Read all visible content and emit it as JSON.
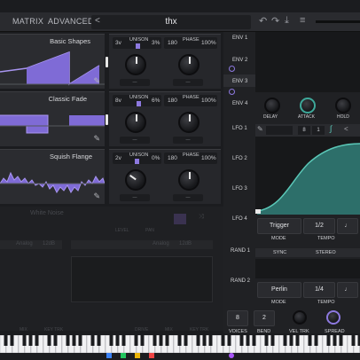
{
  "tabs": [
    "MATRIX",
    "ADVANCED"
  ],
  "preset": {
    "name": "thx",
    "prev": "<",
    "next": ">"
  },
  "oscillators": [
    {
      "wave_name": "Basic Shapes",
      "voices": "3v",
      "unison": "UNISON",
      "unison_pct": "3%",
      "phase_label": "PHASE",
      "phase": "180",
      "phase_pct": "100%"
    },
    {
      "wave_name": "Classic Fade",
      "voices": "8v",
      "unison": "UNISON",
      "unison_pct": "6%",
      "phase_label": "PHASE",
      "phase": "180",
      "phase_pct": "100%"
    },
    {
      "wave_name": "Squish Flange",
      "voices": "2v",
      "unison": "UNISON",
      "unison_pct": "0%",
      "phase_label": "PHASE",
      "phase": "180",
      "phase_pct": "100%"
    }
  ],
  "noise": {
    "name": "White Noise",
    "level": "LEVEL",
    "pan": "PAN"
  },
  "filters": [
    {
      "type": "Analog",
      "slope": "12dB"
    },
    {
      "type": "Analog",
      "slope": "12dB"
    }
  ],
  "filter_caps": [
    "MIX",
    "KEY TRK",
    "DRIVE",
    "MIX",
    "KEY TRK"
  ],
  "env": {
    "labels": [
      "ENV 1",
      "ENV 2",
      "ENV 3",
      "ENV 4"
    ],
    "knobs": [
      "DELAY",
      "ATTACK",
      "HOLD"
    ]
  },
  "lfo": {
    "labels": [
      "LFO 1",
      "LFO 2",
      "LFO 3",
      "LFO 4"
    ],
    "rate_a": "8",
    "rate_b": "1",
    "mode_value": "Trigger",
    "mode_cap": "MODE",
    "tempo_value": "1/2",
    "tempo_cap": "TEMPO"
  },
  "rand": {
    "labels": [
      "RAND 1",
      "RAND 2"
    ],
    "sync": "SYNC",
    "stereo": "STEREO",
    "mode_value": "Perlin",
    "mode_cap": "MODE",
    "tempo_value": "1/4",
    "tempo_cap": "TEMPO"
  },
  "voice": {
    "voices_value": "8",
    "voices_cap": "VOICES",
    "bend_value": "2",
    "bend_cap": "BEND",
    "vel_cap": "VEL TRK",
    "spread_cap": "SPREAD"
  },
  "colors": {
    "accent": "#8d79e0",
    "lfo_fill": "#2d6f6a",
    "lfo_line": "#5bc8b8"
  }
}
